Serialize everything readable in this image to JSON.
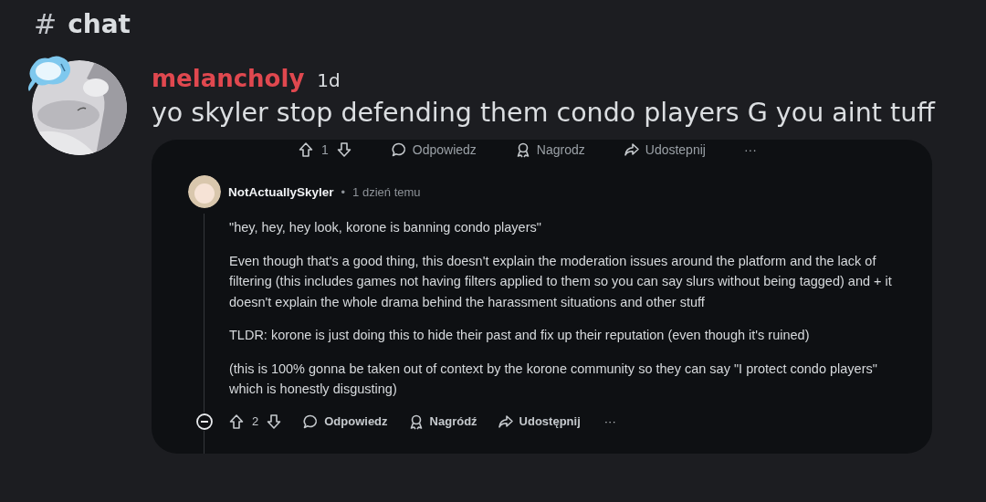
{
  "channel": {
    "hash": "#",
    "name": "chat"
  },
  "message": {
    "author": "melancholy",
    "timestamp": "1d",
    "text": "yo skyler stop defending them condo players G you aint tuff",
    "embed": {
      "cut_actions": {
        "votes": "1",
        "actions": [
          {
            "kind": "reply",
            "label": "Odpowiedz"
          },
          {
            "kind": "award",
            "label": "Nagrodz"
          },
          {
            "kind": "share",
            "label": "Udostepnij"
          }
        ],
        "more": "···"
      },
      "comment": {
        "author": "NotActuallySkyler",
        "separator": "•",
        "time": "1 dzień temu",
        "paragraphs": [
          "\"hey, hey, hey look, korone is banning condo players\"",
          "Even though that's a good thing, this doesn't explain the moderation issues around the platform and the lack of filtering (this includes games not having filters applied to them so you can say slurs without being tagged) and + it doesn't explain the whole drama behind the harassment situations and other stuff",
          "TLDR: korone is just doing this to hide their past and fix up their reputation (even though it's ruined)",
          "(this is 100% gonna be taken out of context by the korone community so they can say \"I protect condo players\" which is honestly disgusting)"
        ]
      },
      "actions": {
        "votes": "2",
        "actions": [
          {
            "kind": "reply",
            "label": "Odpowiedz"
          },
          {
            "kind": "award",
            "label": "Nagródź"
          },
          {
            "kind": "share",
            "label": "Udostępnij"
          }
        ],
        "more": "···"
      }
    }
  }
}
